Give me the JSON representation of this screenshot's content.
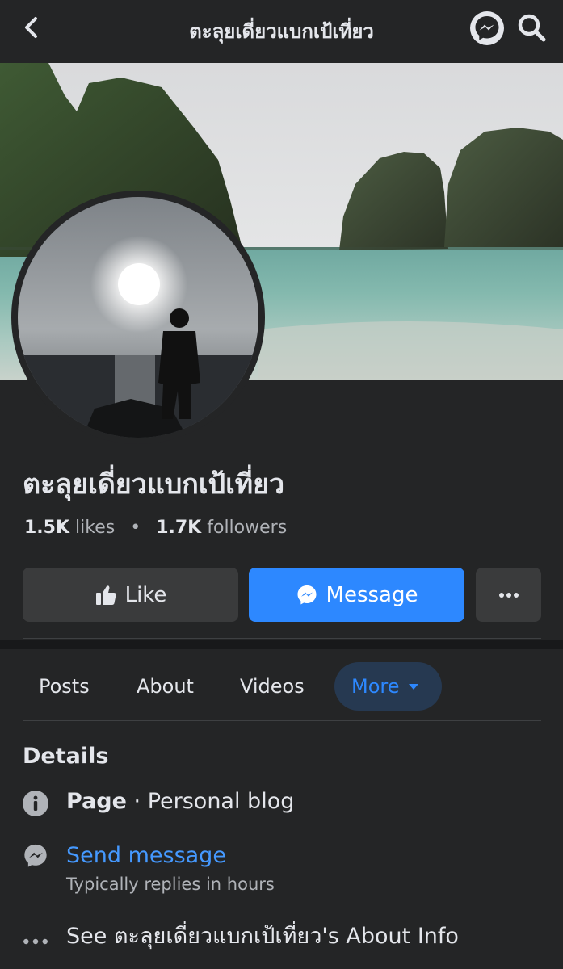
{
  "header": {
    "title": "ตะลุยเดี่ยวแบกเป้เที่ยว",
    "back_icon": "chevron-left-icon",
    "messenger_icon": "messenger-icon",
    "search_icon": "search-icon"
  },
  "profile": {
    "name": "ตะลุยเดี่ยวแบกเป้เที่ยว",
    "likes_count": "1.5K",
    "likes_label": "likes",
    "followers_count": "1.7K",
    "followers_label": "followers"
  },
  "actions": {
    "like_label": "Like",
    "message_label": "Message",
    "more_icon": "ellipsis-icon"
  },
  "tabs": [
    {
      "label": "Posts"
    },
    {
      "label": "About"
    },
    {
      "label": "Videos"
    },
    {
      "label": "More",
      "active": true
    }
  ],
  "details": {
    "title": "Details",
    "category_prefix": "Page",
    "category_value": "· Personal blog",
    "send_message_label": "Send message",
    "reply_time": "Typically replies in hours",
    "about_info": "See ตะลุยเดี่ยวแบกเป้เที่ยว's About Info"
  },
  "colors": {
    "background": "#242526",
    "accent": "#2d88ff",
    "secondary_button": "#3a3b3c",
    "link": "#4599ff"
  }
}
